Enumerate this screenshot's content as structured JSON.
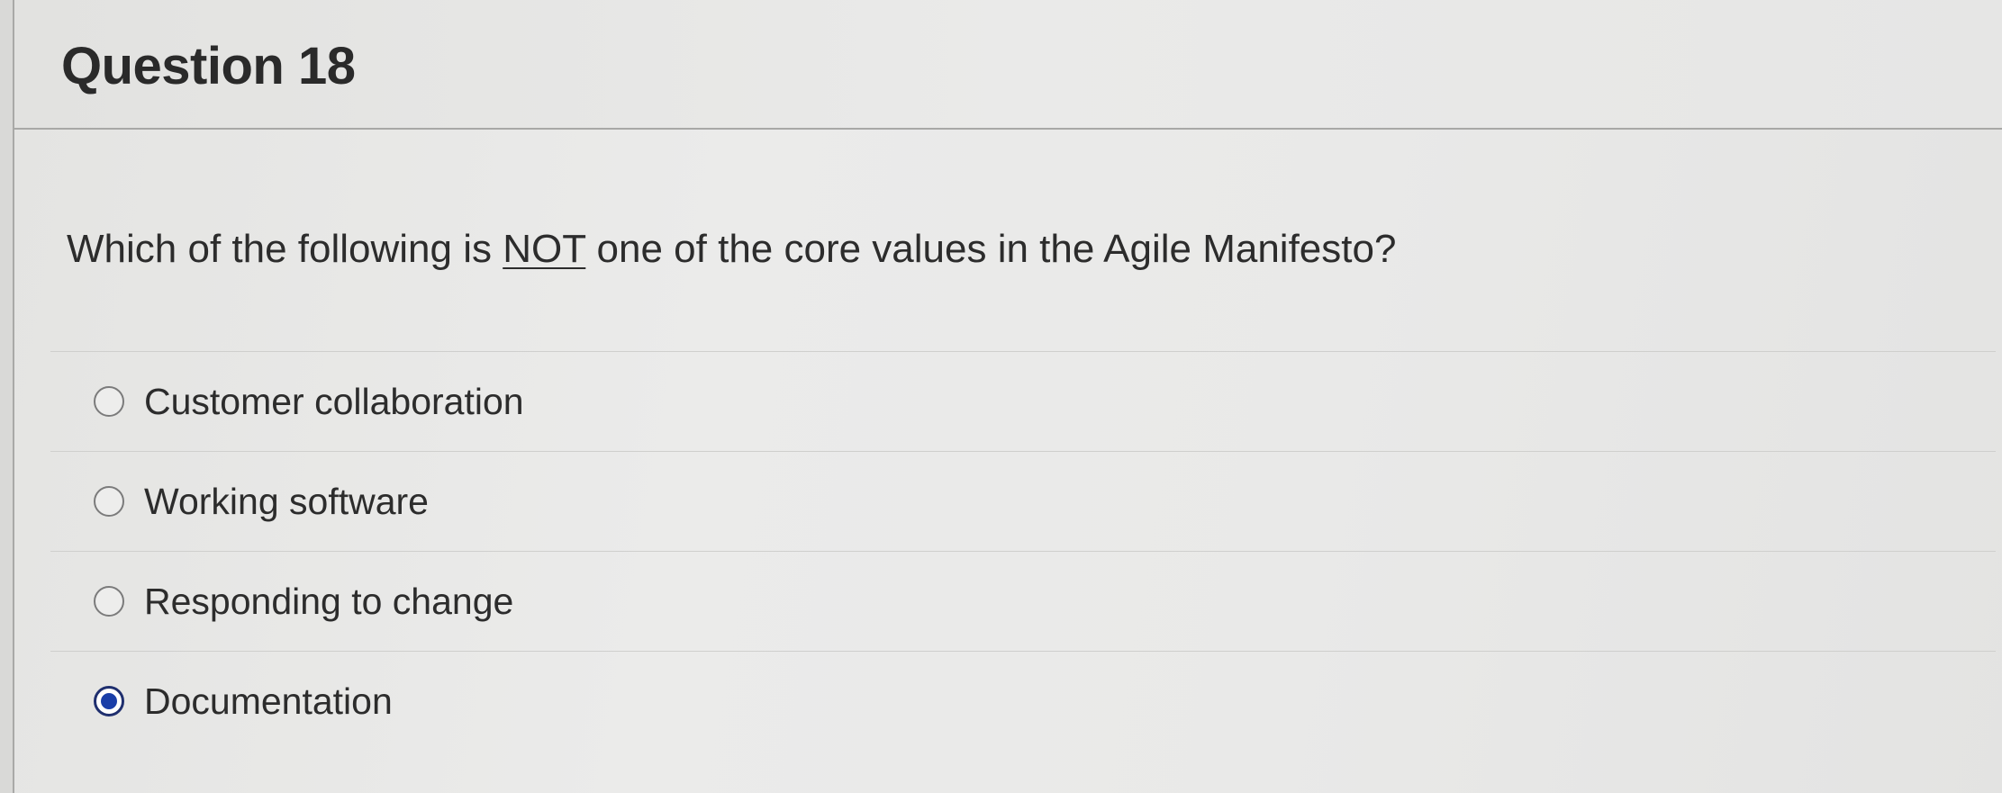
{
  "question": {
    "title": "Question 18",
    "text_before": "Which of the following is ",
    "text_emphasis": "NOT",
    "text_after": " one of the core values in the Agile Manifesto?"
  },
  "answers": [
    {
      "label": "Customer collaboration",
      "selected": false
    },
    {
      "label": "Working software",
      "selected": false
    },
    {
      "label": "Responding to change",
      "selected": false
    },
    {
      "label": "Documentation",
      "selected": true
    }
  ],
  "colors": {
    "radio_selected": "#1a3ea8",
    "radio_border": "#7b7b7b",
    "text": "#2c2c2c"
  }
}
